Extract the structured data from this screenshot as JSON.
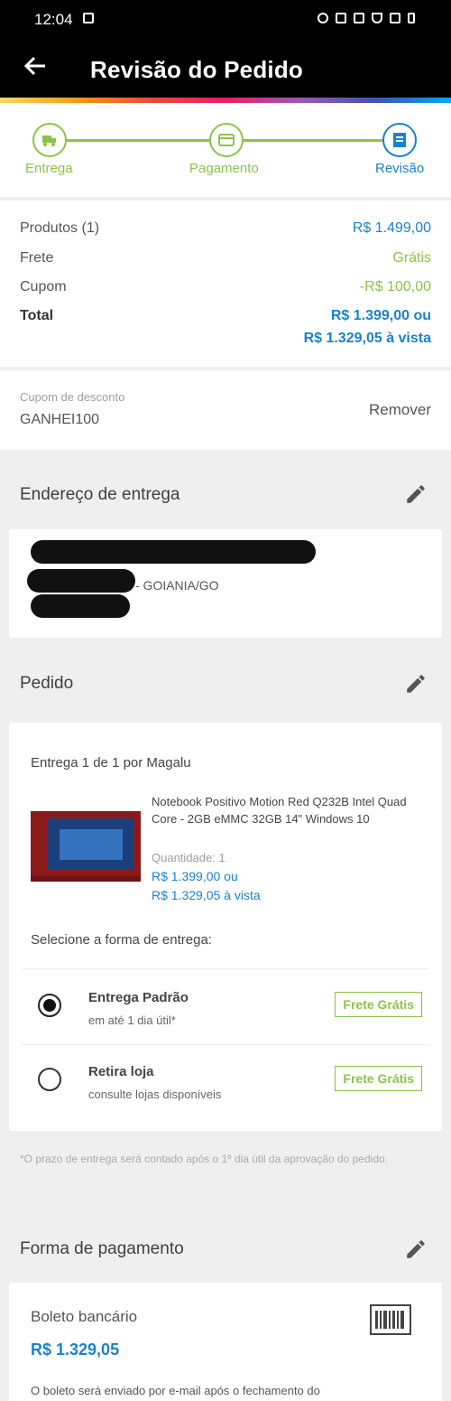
{
  "status": {
    "time": "12:04"
  },
  "header": {
    "title": "Revisão do Pedido"
  },
  "steps": [
    {
      "label": "Entrega",
      "icon": "truck-icon"
    },
    {
      "label": "Pagamento",
      "icon": "card-icon"
    },
    {
      "label": "Revisão",
      "icon": "document-icon"
    }
  ],
  "summary": {
    "products_label": "Produtos (1)",
    "products_value": "R$ 1.499,00",
    "shipping_label": "Frete",
    "shipping_value": "Grátis",
    "coupon_label": "Cupom",
    "coupon_value": "-R$ 100,00",
    "total_label": "Total",
    "total_value": "R$ 1.399,00 ou",
    "total_cash": "R$ 1.329,05 à vista"
  },
  "coupon": {
    "label": "Cupom de desconto",
    "code": "GANHEI100",
    "remove": "Remover"
  },
  "address": {
    "title": "Endereço de entrega",
    "city": "- GOIANIA/GO"
  },
  "order": {
    "title": "Pedido",
    "delivery_of": "Entrega 1 de 1 por Magalu",
    "product_name": "Notebook Positivo Motion Red Q232B Intel Quad Core - 2GB eMMC 32GB 14\" Windows 10",
    "quantity": "Quantidade: 1",
    "price": "R$ 1.399,00 ou",
    "price_cash": "R$ 1.329,05 à vista",
    "select_delivery": "Selecione a forma de entrega:",
    "options": [
      {
        "title": "Entrega Padrão",
        "subtitle": "em até 1 dia útil*",
        "badge": "Frete Grátis",
        "selected": true
      },
      {
        "title": "Retira loja",
        "subtitle": "consulte lojas disponíveis",
        "badge": "Frete Grátis",
        "selected": false
      }
    ],
    "note": "*O prazo de entrega será contado após o 1º dia útil da aprovação do pedido."
  },
  "payment": {
    "title": "Forma de pagamento",
    "method": "Boleto bancário",
    "amount": "R$ 1.329,05",
    "info": "O boleto será enviado por e-mail após o fechamento do"
  },
  "colors": {
    "green": "#8bc34a",
    "blue": "#1a82c9",
    "bar": "#000000"
  }
}
